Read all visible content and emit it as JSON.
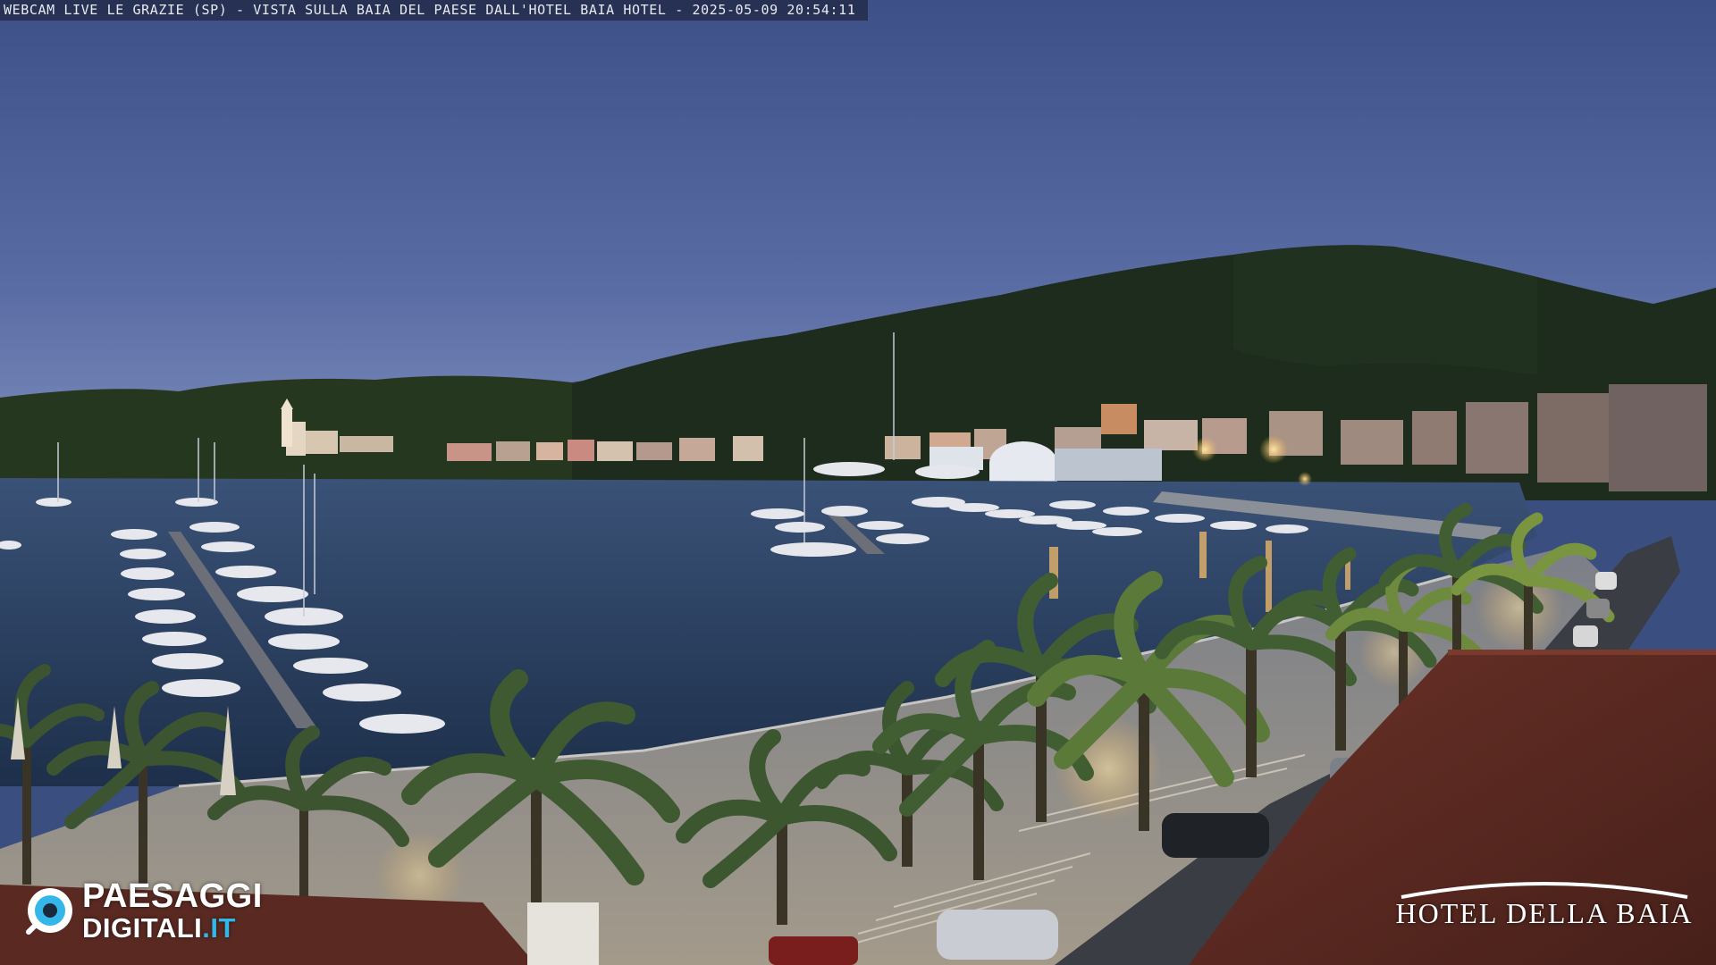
{
  "overlay": {
    "title": "WEBCAM LIVE LE GRAZIE (SP) - VISTA SULLA BAIA DEL PAESE DALL'HOTEL BAIA HOTEL - 2025-05-09 20:54:11"
  },
  "logo_left": {
    "line1": "PAESAGGI",
    "line2": "DIGITALI",
    "line2_suffix": ".IT",
    "accent_color": "#35b6e8",
    "icon": "eye-icon"
  },
  "logo_right": {
    "text": "HOTEL DELLA BAIA"
  },
  "colors": {
    "sky_top": "#3f5389",
    "sky_bottom": "#7486b8",
    "hill": "#1c2c1f",
    "water": "#253a58",
    "roof": "#5e2a22",
    "promenade": "#8a8e96",
    "lamp_glow": "#ffcc66"
  }
}
